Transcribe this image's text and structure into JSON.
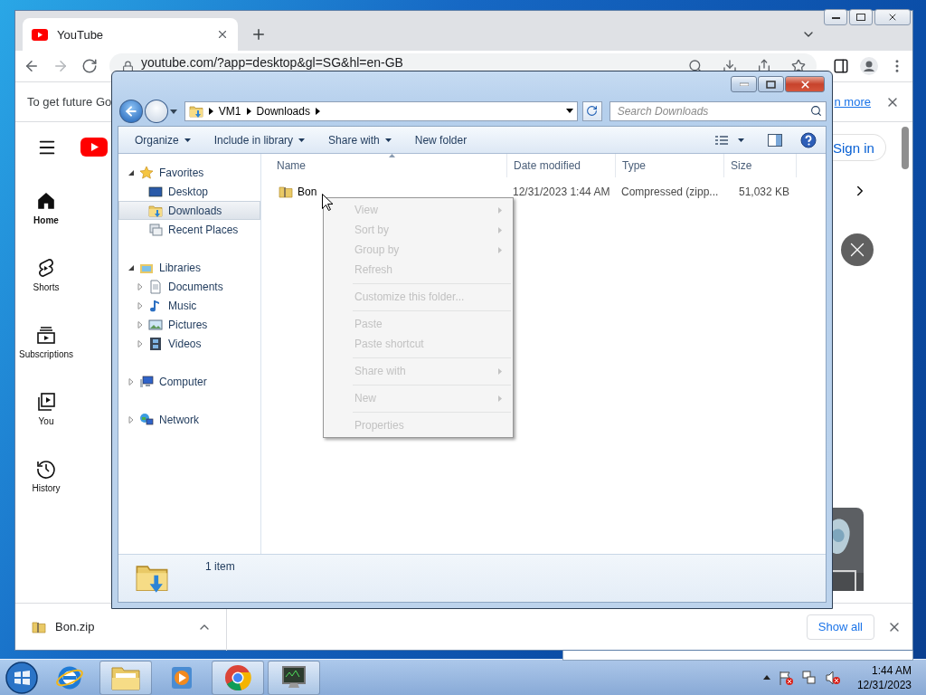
{
  "browser": {
    "tabs": [
      {
        "label": "YouTube",
        "selected": true
      }
    ],
    "nav_buttons": [
      {
        "kind": "back",
        "disabled": false
      },
      {
        "kind": "forward",
        "disabled": true
      },
      {
        "kind": "reload",
        "disabled": false
      }
    ],
    "address": {
      "value": "youtube.com/?app=desktop&gl=SG&hl=en-GB"
    },
    "infobar": {
      "text": "To get future Go",
      "link": "n more"
    },
    "youtube": {
      "sidebar": [
        {
          "kind": "home",
          "label": "Home",
          "selected": true
        },
        {
          "kind": "shorts",
          "label": "Shorts",
          "selected": false
        },
        {
          "kind": "subscriptions",
          "label": "Subscriptions",
          "selected": false
        },
        {
          "kind": "you",
          "label": "You",
          "selected": false
        },
        {
          "kind": "history",
          "label": "History",
          "selected": false
        }
      ],
      "sign_in": "Sign in"
    },
    "download_bar": {
      "file": "Bon.zip",
      "show_all": "Show all"
    }
  },
  "explorer": {
    "breadcrumb": [
      "VM1",
      "Downloads"
    ],
    "search": {
      "placeholder": "Search Downloads"
    },
    "toolbar": [
      {
        "label": "Organize",
        "menu": true
      },
      {
        "label": "Include in library",
        "menu": true
      },
      {
        "label": "Share with",
        "menu": true
      },
      {
        "label": "New folder",
        "menu": false
      }
    ],
    "nav": [
      {
        "kind": "favorites",
        "label": "Favorites",
        "expanded": true,
        "selected": false,
        "children": [
          {
            "kind": "desktop",
            "label": "Desktop",
            "selected": false
          },
          {
            "kind": "downloads",
            "label": "Downloads",
            "selected": true
          },
          {
            "kind": "recent",
            "label": "Recent Places",
            "selected": false
          }
        ]
      },
      {
        "kind": "libraries",
        "label": "Libraries",
        "expanded": true,
        "selected": false,
        "children": [
          {
            "kind": "documents",
            "label": "Documents",
            "expanded": false,
            "selected": false
          },
          {
            "kind": "music",
            "label": "Music",
            "expanded": false,
            "selected": false
          },
          {
            "kind": "pictures",
            "label": "Pictures",
            "expanded": false,
            "selected": false
          },
          {
            "kind": "videos",
            "label": "Videos",
            "expanded": false,
            "selected": false
          }
        ]
      },
      {
        "kind": "computer",
        "label": "Computer",
        "expanded": false,
        "selected": false
      },
      {
        "kind": "network",
        "label": "Network",
        "expanded": false,
        "selected": false
      }
    ],
    "columns": [
      {
        "label": "Name",
        "sorted": true
      },
      {
        "label": "Date modified",
        "sorted": false
      },
      {
        "label": "Type",
        "sorted": false
      },
      {
        "label": "Size",
        "sorted": false
      }
    ],
    "files": [
      {
        "name": "Bon",
        "date": "12/31/2023 1:44 AM",
        "type": "Compressed (zipp...",
        "size": "51,032 KB"
      }
    ],
    "status": "1 item"
  },
  "context_menu": [
    {
      "kind": "item",
      "label": "View",
      "disabled": true,
      "submenu": true
    },
    {
      "kind": "item",
      "label": "Sort by",
      "disabled": true,
      "submenu": true
    },
    {
      "kind": "item",
      "label": "Group by",
      "disabled": true,
      "submenu": true
    },
    {
      "kind": "item",
      "label": "Refresh",
      "disabled": true,
      "submenu": false
    },
    {
      "kind": "separator"
    },
    {
      "kind": "item",
      "label": "Customize this folder...",
      "disabled": true,
      "submenu": false
    },
    {
      "kind": "separator"
    },
    {
      "kind": "item",
      "label": "Paste",
      "disabled": true,
      "submenu": false
    },
    {
      "kind": "item",
      "label": "Paste shortcut",
      "disabled": true,
      "submenu": false
    },
    {
      "kind": "separator"
    },
    {
      "kind": "item",
      "label": "Share with",
      "disabled": true,
      "submenu": true
    },
    {
      "kind": "separator"
    },
    {
      "kind": "item",
      "label": "New",
      "disabled": true,
      "submenu": true
    },
    {
      "kind": "separator"
    },
    {
      "kind": "item",
      "label": "Properties",
      "disabled": true,
      "submenu": false
    }
  ],
  "taskbar": {
    "apps": [
      {
        "kind": "ie",
        "active": false
      },
      {
        "kind": "explorer",
        "active": true
      },
      {
        "kind": "media",
        "active": false
      },
      {
        "kind": "chrome",
        "active": true
      },
      {
        "kind": "monitor",
        "active": true
      }
    ],
    "clock": {
      "time": "1:44 AM",
      "date": "12/31/2023"
    }
  }
}
